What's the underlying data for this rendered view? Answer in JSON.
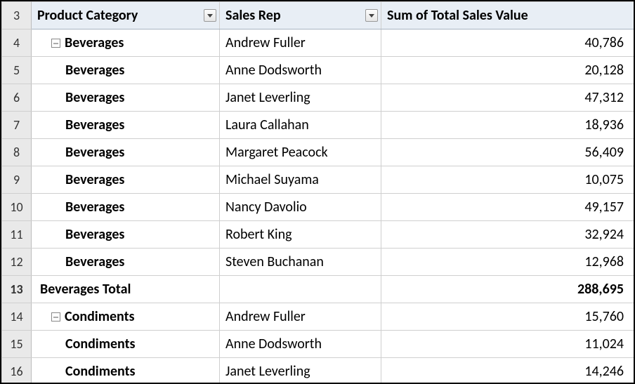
{
  "headers": {
    "category": "Product Category",
    "rep": "Sales Rep",
    "value": "Sum of Total Sales Value"
  },
  "rows": [
    {
      "num": "3",
      "type": "header"
    },
    {
      "num": "4",
      "type": "data",
      "first": true,
      "category": "Beverages",
      "rep": "Andrew Fuller",
      "value": "40,786"
    },
    {
      "num": "5",
      "type": "data",
      "first": false,
      "category": "Beverages",
      "rep": "Anne Dodsworth",
      "value": "20,128"
    },
    {
      "num": "6",
      "type": "data",
      "first": false,
      "category": "Beverages",
      "rep": "Janet Leverling",
      "value": "47,312"
    },
    {
      "num": "7",
      "type": "data",
      "first": false,
      "category": "Beverages",
      "rep": "Laura Callahan",
      "value": "18,936"
    },
    {
      "num": "8",
      "type": "data",
      "first": false,
      "category": "Beverages",
      "rep": "Margaret Peacock",
      "value": "56,409"
    },
    {
      "num": "9",
      "type": "data",
      "first": false,
      "category": "Beverages",
      "rep": "Michael Suyama",
      "value": "10,075"
    },
    {
      "num": "10",
      "type": "data",
      "first": false,
      "category": "Beverages",
      "rep": "Nancy Davolio",
      "value": "49,157"
    },
    {
      "num": "11",
      "type": "data",
      "first": false,
      "category": "Beverages",
      "rep": "Robert King",
      "value": "32,924"
    },
    {
      "num": "12",
      "type": "data",
      "first": false,
      "category": "Beverages",
      "rep": "Steven Buchanan",
      "value": "12,968"
    },
    {
      "num": "13",
      "type": "total",
      "category": "Beverages Total",
      "rep": "",
      "value": "288,695"
    },
    {
      "num": "14",
      "type": "data",
      "first": true,
      "category": "Condiments",
      "rep": "Andrew Fuller",
      "value": "15,760"
    },
    {
      "num": "15",
      "type": "data",
      "first": false,
      "category": "Condiments",
      "rep": "Anne Dodsworth",
      "value": "11,024"
    },
    {
      "num": "16",
      "type": "data",
      "first": false,
      "category": "Condiments",
      "rep": "Janet Leverling",
      "value": "14,246"
    }
  ]
}
